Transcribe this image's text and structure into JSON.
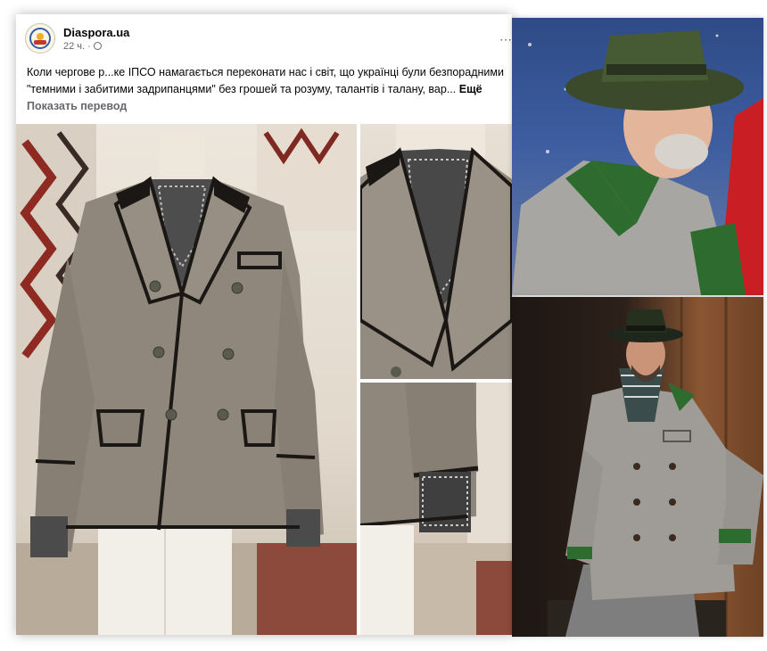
{
  "post": {
    "page_name": "Diaspora.ua",
    "time": "22 ч.",
    "separator": "·",
    "more_options": "⋯",
    "text": "Коли чергове р...ке ІПСО намагається переконати нас і світ, що українці були безпорадними \"темними і забитими задрипанцями\" без грошей та розуму, талантів і талану, вар...",
    "more_label": "Ещё",
    "translate_label": "Показать перевод"
  },
  "icons": {
    "avatar": "diaspora-logo",
    "privacy": "globe-icon",
    "options": "more-options-icon"
  },
  "colors": {
    "link_gray": "#65676b",
    "text": "#050505",
    "jacket_gray": "#8f877c",
    "trim_black": "#1a1714",
    "loden_green": "#2e6b2f"
  }
}
